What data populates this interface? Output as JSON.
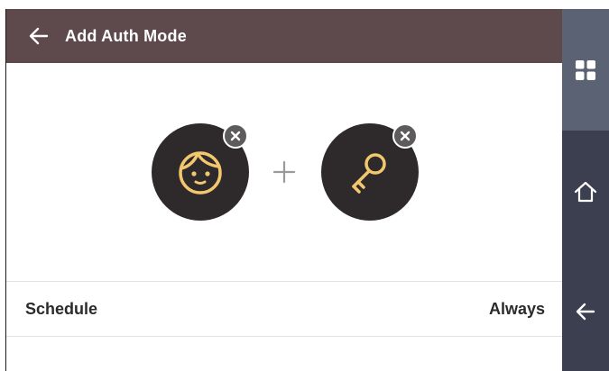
{
  "header": {
    "title": "Add Auth Mode"
  },
  "auth_methods": [
    {
      "name": "Face",
      "icon": "face-icon"
    },
    {
      "name": "Card Key",
      "icon": "key-icon"
    }
  ],
  "rows": {
    "schedule": {
      "label": "Schedule",
      "value": "Always"
    }
  },
  "icons": {
    "back": "back-arrow-icon",
    "remove": "close-icon",
    "plus": "plus-icon",
    "menu": "grid-icon",
    "home": "home-icon",
    "nav_back": "back-arrow-icon"
  },
  "colors": {
    "header": "#5e4a4d",
    "accent_icon": "#f3c76d",
    "circle": "#2e2a2b",
    "nav_active": "#5b6274",
    "nav": "#3b3f4f"
  }
}
